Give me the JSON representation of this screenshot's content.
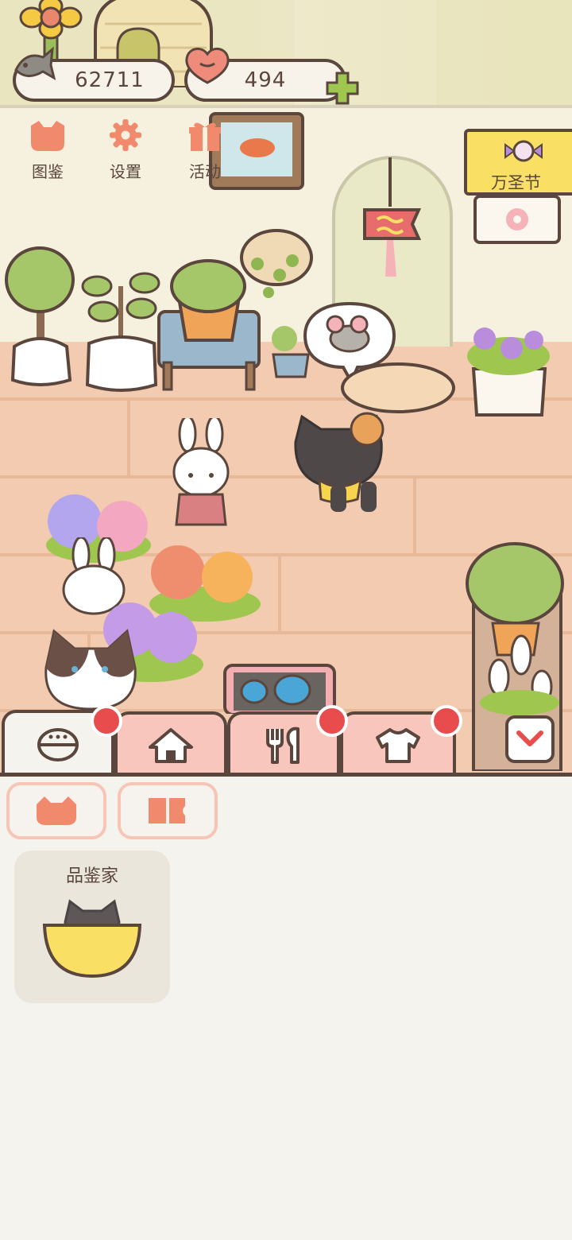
{
  "currency": {
    "fish_icon": "fish-icon",
    "fish_amount": "62711",
    "heart_icon": "heart-icon",
    "heart_amount": "494",
    "add_icon": "plus-icon"
  },
  "menu": {
    "items": [
      {
        "icon": "cat-face-icon",
        "label": "图鉴"
      },
      {
        "icon": "gear-icon",
        "label": "设置"
      },
      {
        "icon": "gift-icon",
        "label": "活动"
      }
    ]
  },
  "event": {
    "icon": "candy-icon",
    "label": "万圣节"
  },
  "tabs": [
    {
      "icon": "food-bowl-icon",
      "active": true,
      "badge": true
    },
    {
      "icon": "house-icon",
      "active": false,
      "badge": false
    },
    {
      "icon": "fork-knife-icon",
      "active": false,
      "badge": true
    },
    {
      "icon": "shirt-icon",
      "active": false,
      "badge": true
    }
  ],
  "collapse_icon": "chevron-down-icon",
  "filters": [
    {
      "icon": "cat-head-icon"
    },
    {
      "icon": "ticket-icon"
    }
  ],
  "cards": [
    {
      "title": "品鉴家",
      "icon": "cat-in-bowl-icon"
    }
  ],
  "colors": {
    "outline": "#5a463c",
    "tab_pink": "#f8c6bd",
    "badge_red": "#e84c4c",
    "banner_yellow": "#f9df63",
    "panel_bg": "#f5f3ee",
    "floor": "#f2cbb0"
  }
}
